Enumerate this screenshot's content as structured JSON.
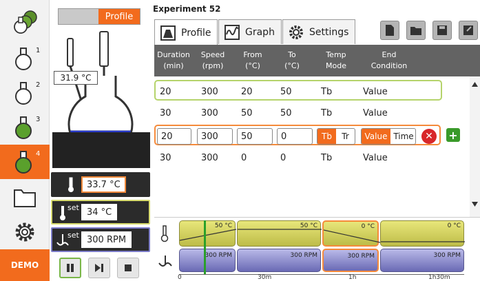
{
  "nav": {
    "items": [
      {
        "name": "all-reactors",
        "sup": ""
      },
      {
        "name": "reactor-1",
        "sup": "1"
      },
      {
        "name": "reactor-2",
        "sup": "2"
      },
      {
        "name": "reactor-3",
        "sup": "3"
      },
      {
        "name": "reactor-4",
        "sup": "4"
      },
      {
        "name": "files",
        "sup": ""
      },
      {
        "name": "settings",
        "sup": ""
      }
    ],
    "demo_label": "DEMO"
  },
  "reactor": {
    "mode_toggle_label": "Profile",
    "probe_temp": "31.9 °C",
    "temperature": "33.7 °C",
    "set_temperature": "34 °C",
    "set_speed": "300 RPM",
    "set_label": "set",
    "colors": {
      "accent": "#f26b1d",
      "temp_border": "#f58a3a",
      "set_temp_border": "#d8db6e",
      "set_speed_border": "#7c7cc9",
      "liquid": "#2d3ed8"
    }
  },
  "experiment": {
    "title": "Experiment 52",
    "tabs": [
      {
        "label": "Profile",
        "icon": "profile-icon"
      },
      {
        "label": "Graph",
        "icon": "graph-icon"
      },
      {
        "label": "Settings",
        "icon": "gear-icon"
      }
    ],
    "toolbar": [
      "new-file-icon",
      "open-folder-icon",
      "save-icon",
      "save-as-icon"
    ]
  },
  "table": {
    "headers": [
      {
        "l1": "Duration",
        "l2": "(min)"
      },
      {
        "l1": "Speed",
        "l2": "(rpm)"
      },
      {
        "l1": "From",
        "l2": "(°C)"
      },
      {
        "l1": "To",
        "l2": "(°C)"
      },
      {
        "l1": "Temp",
        "l2": "Mode"
      },
      {
        "l1": "End",
        "l2": "Condition"
      }
    ],
    "rows": [
      {
        "duration": "20",
        "speed": "300",
        "from": "20",
        "to": "50",
        "mode": "Tb",
        "end": "Value"
      },
      {
        "duration": "30",
        "speed": "300",
        "from": "50",
        "to": "50",
        "mode": "Tb",
        "end": "Value"
      },
      {
        "duration": "20",
        "speed": "300",
        "from": "50",
        "to": "0",
        "mode_options": [
          "Tb",
          "Tr"
        ],
        "mode_selected": "Tb",
        "end_options": [
          "Value",
          "Time"
        ],
        "end_selected": "Value"
      },
      {
        "duration": "30",
        "speed": "300",
        "from": "0",
        "to": "0",
        "mode": "Tb",
        "end": "Value"
      }
    ]
  },
  "timeline": {
    "temp_labels": [
      "50 °C",
      "50 °C",
      "0 °C",
      "0 °C"
    ],
    "speed_labels": [
      "300 RPM",
      "300 RPM",
      "300 RPM",
      "300 RPM"
    ],
    "axis": [
      "0",
      "30m",
      "1h",
      "1h30m"
    ]
  }
}
